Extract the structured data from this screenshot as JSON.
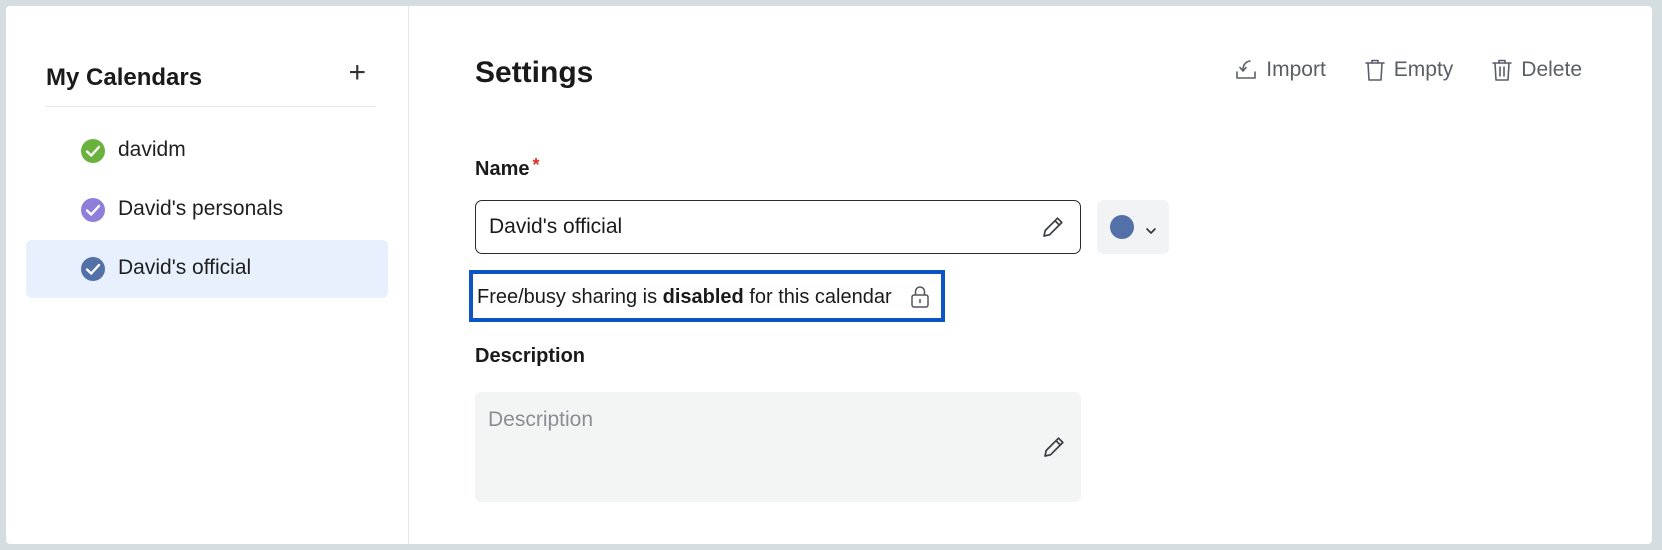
{
  "sidebar": {
    "title": "My Calendars",
    "add_label": "+",
    "items": [
      {
        "label": "davidm",
        "color": "#6ab23e",
        "active": false
      },
      {
        "label": "David's personals",
        "color": "#8f7fdb",
        "active": false
      },
      {
        "label": "David's official",
        "color": "#5470a8",
        "active": true
      }
    ]
  },
  "main": {
    "title": "Settings",
    "toolbar": {
      "import_label": "Import",
      "empty_label": "Empty",
      "delete_label": "Delete"
    },
    "name_field": {
      "label": "Name",
      "required_mark": "*",
      "value": "David's official"
    },
    "color_picker": {
      "selected_color": "#5470a8"
    },
    "freebusy": {
      "prefix": "Free/busy sharing is",
      "emphasis": "disabled",
      "suffix": "for this calendar"
    },
    "description_field": {
      "label": "Description",
      "placeholder": "Description"
    }
  },
  "colors": {
    "accent_border": "#0d55c7",
    "active_bg": "#e8f0fd",
    "required": "#d93025"
  }
}
